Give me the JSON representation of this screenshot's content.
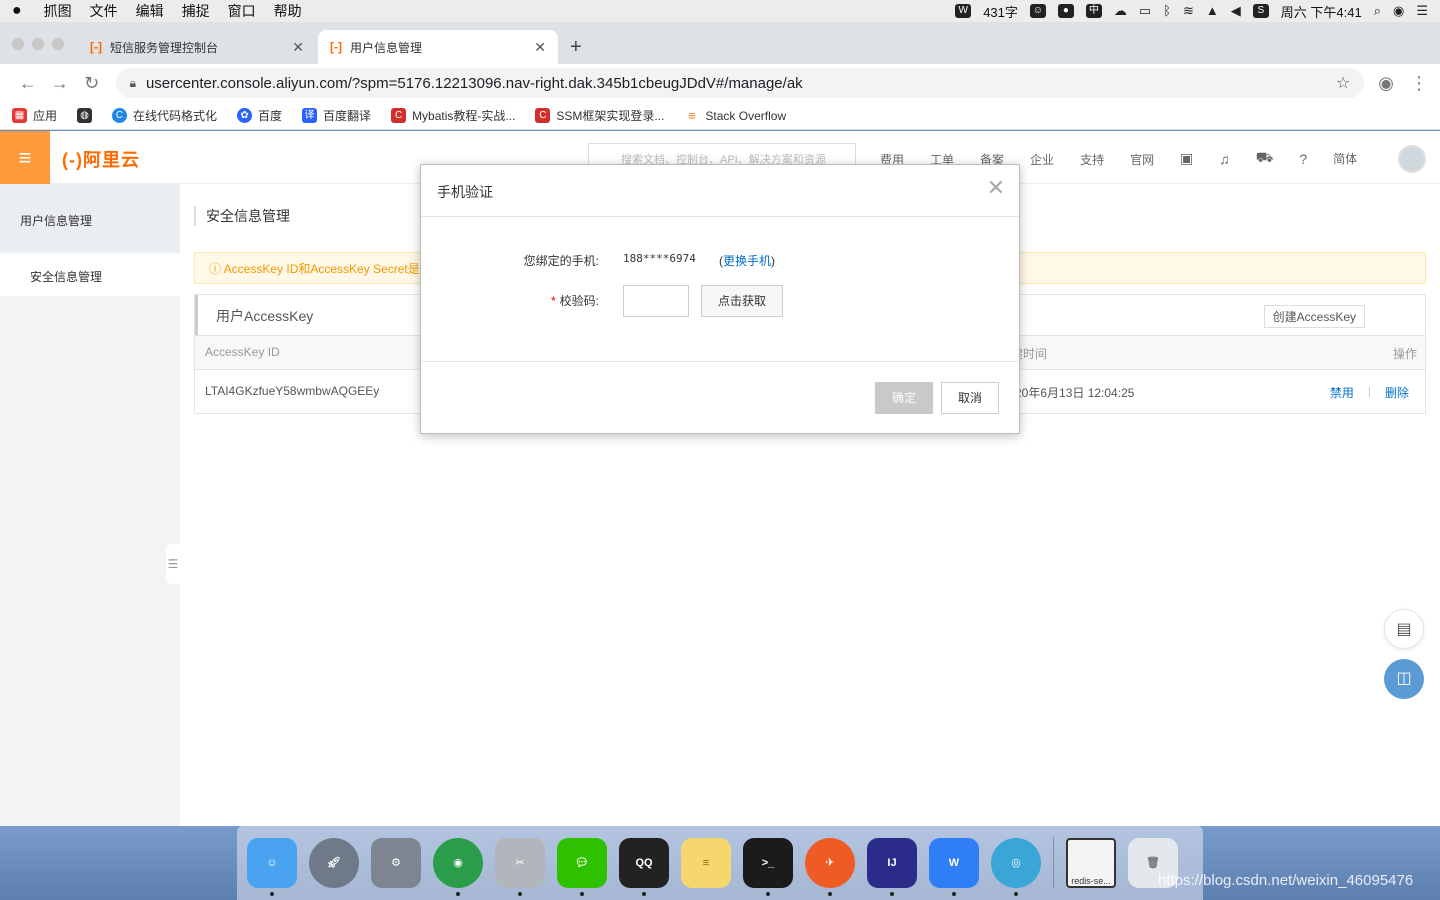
{
  "menubar": {
    "apple": "",
    "items": [
      "抓图",
      "文件",
      "编辑",
      "捕捉",
      "窗口",
      "帮助"
    ],
    "word_count": "431字",
    "clock": "周六 下午4:41"
  },
  "browser": {
    "tabs": [
      {
        "label": "短信服务管理控制台",
        "favicon": "[-]"
      },
      {
        "label": "用户信息管理",
        "favicon": "[-]"
      }
    ],
    "new_tab": "+",
    "url": "usercenter.console.aliyun.com/?spm=5176.12213096.nav-right.dak.345b1cbeugJDdV#/manage/ak",
    "bookmarks": [
      {
        "label": "应用",
        "icon": "apps-grid-icon",
        "color": "#e53935"
      },
      {
        "label": "",
        "icon": "globe-icon",
        "color": "#333333"
      },
      {
        "label": "在线代码格式化",
        "icon": "c-icon",
        "color": "#1e88e5"
      },
      {
        "label": "百度",
        "icon": "baidu-paw-icon",
        "color": "#2962ff"
      },
      {
        "label": "百度翻译",
        "icon": "translate-icon",
        "color": "#2962ff"
      },
      {
        "label": "Mybatis教程-实战...",
        "icon": "c-red-icon",
        "color": "#d32f2f"
      },
      {
        "label": "SSM框架实现登录...",
        "icon": "c-red-icon",
        "color": "#d32f2f"
      },
      {
        "label": "Stack Overflow",
        "icon": "stackoverflow-icon",
        "color": "#f48024"
      }
    ]
  },
  "site": {
    "logo": "(-)阿里云",
    "search_placeholder": "搜索文档、控制台、API、解决方案和资源",
    "nav_links": [
      "费用",
      "工单",
      "备案",
      "企业",
      "支持",
      "官网"
    ],
    "lang": "简体",
    "sidebar": {
      "heading": "用户信息管理",
      "items": [
        "安全信息管理"
      ]
    },
    "page_title": "安全信息管理",
    "alert": "ⓘ AccessKey ID和AccessKey Secret是",
    "panel": {
      "title": "用户AccessKey",
      "create_button": "创建AccessKey",
      "columns": {
        "id": "AccessKey ID",
        "created": "建时间",
        "ops": "操作"
      },
      "rows": [
        {
          "id": "LTAI4GKzfueY58wmbwAQGEEy",
          "created": "20年6月13日 12:04:25",
          "disable": "禁用",
          "delete": "删除"
        }
      ]
    }
  },
  "dialog": {
    "title": "手机验证",
    "phone_label": "您绑定的手机:",
    "phone_value": "188****6974",
    "change_prefix": "(",
    "change_link": "更换手机",
    "change_suffix": ")",
    "code_label": "校验码:",
    "required_mark": "*",
    "get_code_button": "点击获取",
    "ok_button": "确定",
    "cancel_button": "取消"
  },
  "dock": {
    "apps": [
      {
        "name": "Finder",
        "icon": "finder-icon",
        "color": "#4aa3f0"
      },
      {
        "name": "Launchpad",
        "icon": "rocket-icon",
        "color": "#6f7a88"
      },
      {
        "name": "System Preferences",
        "icon": "gear-icon",
        "color": "#7d8590"
      },
      {
        "name": "Chrome",
        "icon": "chrome-icon",
        "color": "#2a9d4a"
      },
      {
        "name": "Snipaste",
        "icon": "scissors-icon",
        "color": "#b0b6bc"
      },
      {
        "name": "WeChat",
        "icon": "wechat-icon",
        "color": "#2dc100"
      },
      {
        "name": "QQ",
        "icon": "penguin-icon",
        "color": "#222222"
      },
      {
        "name": "Notes",
        "icon": "notes-icon",
        "color": "#f5d76e"
      },
      {
        "name": "Terminal",
        "icon": "terminal-icon",
        "color": "#1b1b1b"
      },
      {
        "name": "Postman",
        "icon": "postman-icon",
        "color": "#ef5b25"
      },
      {
        "name": "IntelliJ IDEA",
        "icon": "intellij-icon",
        "color": "#2b2b8a"
      },
      {
        "name": "WPS",
        "icon": "wps-icon",
        "color": "#2f7ef5"
      },
      {
        "name": "Navicat",
        "icon": "navicat-icon",
        "color": "#3aa6d8"
      }
    ],
    "minimized_window": "redis-se...",
    "trash": "trash-icon"
  },
  "watermark": "https://blog.csdn.net/weixin_46095476"
}
